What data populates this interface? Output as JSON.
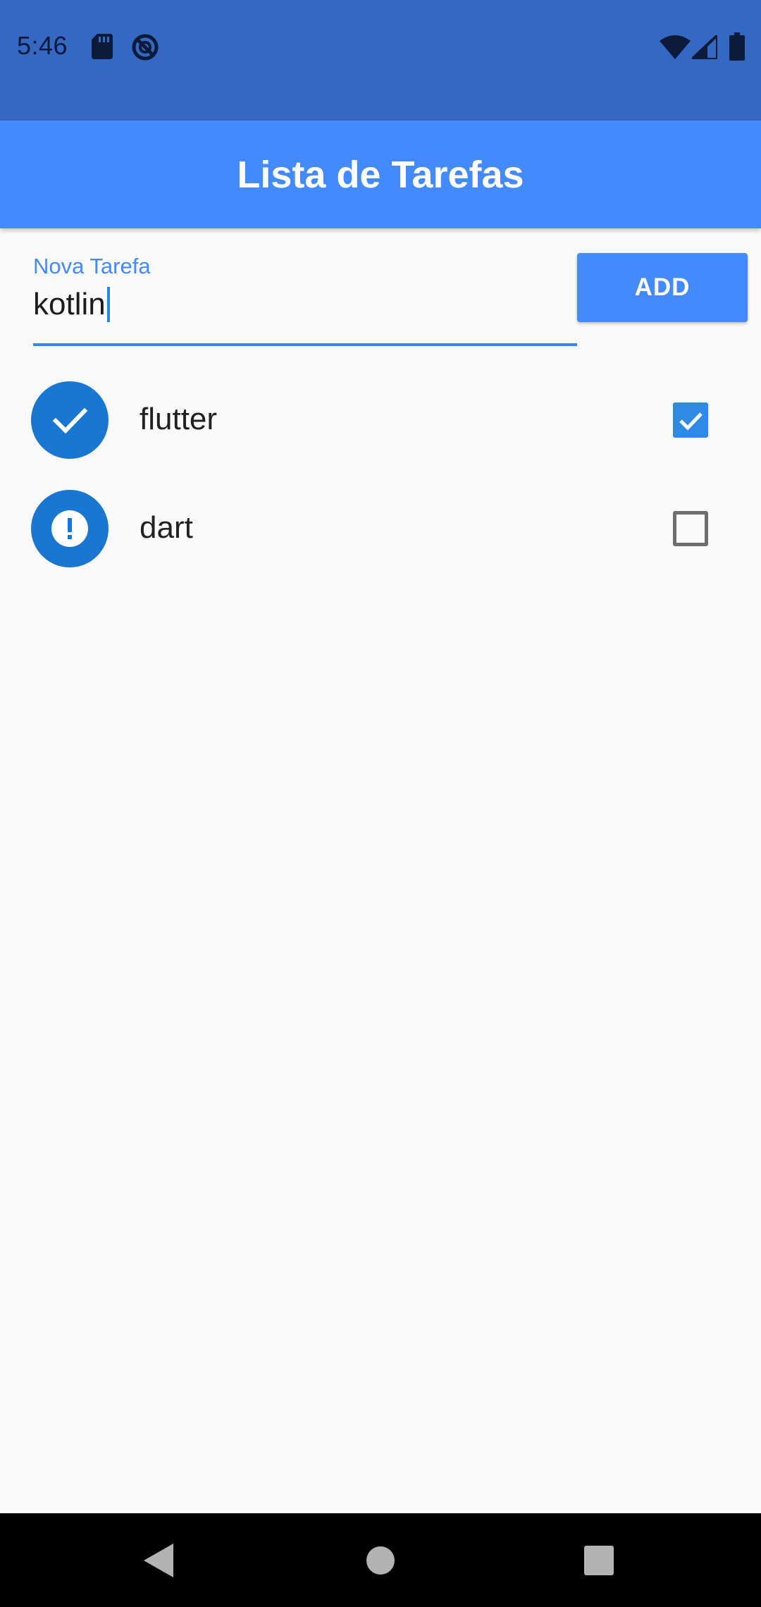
{
  "status_bar": {
    "time": "5:46",
    "icons": [
      "sd-card-icon",
      "do-not-disturb-icon",
      "wifi-icon",
      "cell-signal-icon",
      "battery-icon"
    ]
  },
  "app_bar": {
    "title": "Lista de Tarefas",
    "color": "#448aff"
  },
  "new_task": {
    "label": "Nova Tarefa",
    "value": "kotlin"
  },
  "add_button": {
    "label": "ADD"
  },
  "tasks": [
    {
      "label": "flutter",
      "done": true,
      "icon": "check-icon"
    },
    {
      "label": "dart",
      "done": false,
      "icon": "error-icon"
    }
  ],
  "nav_bar": {
    "buttons": [
      "back-icon",
      "home-icon",
      "recents-icon"
    ]
  },
  "colors": {
    "accent": "#448aff",
    "avatar": "#1976d2",
    "status_bar": "#3568c2"
  }
}
